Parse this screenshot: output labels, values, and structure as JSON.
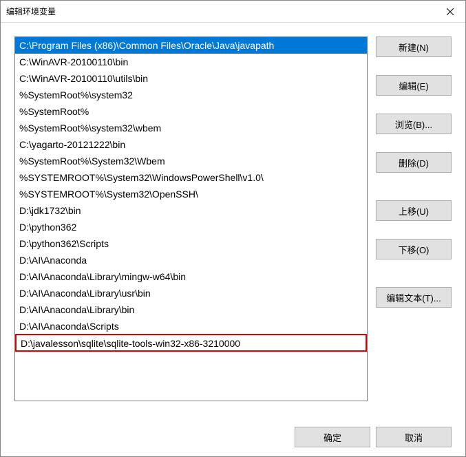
{
  "dialog": {
    "title": "编辑环境变量"
  },
  "list": {
    "items": [
      "C:\\Program Files (x86)\\Common Files\\Oracle\\Java\\javapath",
      "C:\\WinAVR-20100110\\bin",
      "C:\\WinAVR-20100110\\utils\\bin",
      "%SystemRoot%\\system32",
      "%SystemRoot%",
      "%SystemRoot%\\system32\\wbem",
      "C:\\yagarto-20121222\\bin",
      "%SystemRoot%\\System32\\Wbem",
      "%SYSTEMROOT%\\System32\\WindowsPowerShell\\v1.0\\",
      "%SYSTEMROOT%\\System32\\OpenSSH\\",
      "D:\\jdk1732\\bin",
      "D:\\python362",
      "D:\\python362\\Scripts",
      "D:\\AI\\Anaconda",
      "D:\\AI\\Anaconda\\Library\\mingw-w64\\bin",
      "D:\\AI\\Anaconda\\Library\\usr\\bin",
      "D:\\AI\\Anaconda\\Library\\bin",
      "D:\\AI\\Anaconda\\Scripts",
      "D:\\javalesson\\sqlite\\sqlite-tools-win32-x86-3210000"
    ],
    "selected_index": 0,
    "highlighted_index": 18
  },
  "buttons": {
    "new": "新建(N)",
    "edit": "编辑(E)",
    "browse": "浏览(B)...",
    "delete": "删除(D)",
    "move_up": "上移(U)",
    "move_down": "下移(O)",
    "edit_text": "编辑文本(T)...",
    "ok": "确定",
    "cancel": "取消"
  }
}
